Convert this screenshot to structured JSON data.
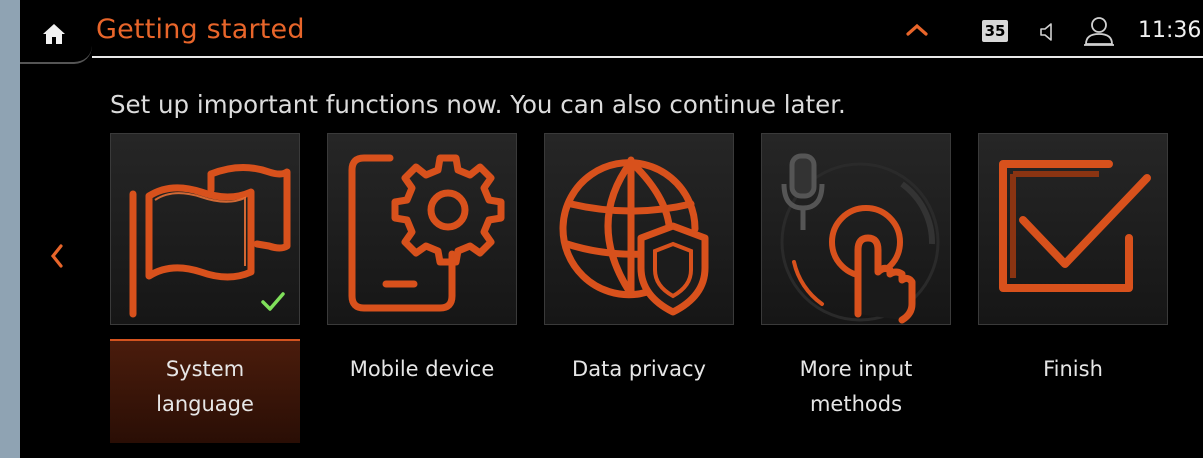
{
  "header": {
    "title": "Getting started",
    "temperature": "35",
    "time": "11:36",
    "icons": [
      "home-icon",
      "chevron-up-icon",
      "volume-icon",
      "user-icon"
    ]
  },
  "subtitle": "Set up important functions now. You can also continue later.",
  "tiles": [
    {
      "label": "System language",
      "icon": "flags-icon",
      "completed": true,
      "selected": true
    },
    {
      "label": "Mobile device",
      "icon": "phone-gear-icon",
      "completed": false,
      "selected": false
    },
    {
      "label": "Data privacy",
      "icon": "globe-shield-icon",
      "completed": false,
      "selected": false
    },
    {
      "label": "More input methods",
      "icon": "microphone-touch-icon",
      "completed": false,
      "selected": false
    },
    {
      "label": "Finish",
      "icon": "checkbox-icon",
      "completed": false,
      "selected": false
    }
  ],
  "colors": {
    "accent": "#e8652a",
    "background": "#000000",
    "check": "#7fe05a"
  }
}
